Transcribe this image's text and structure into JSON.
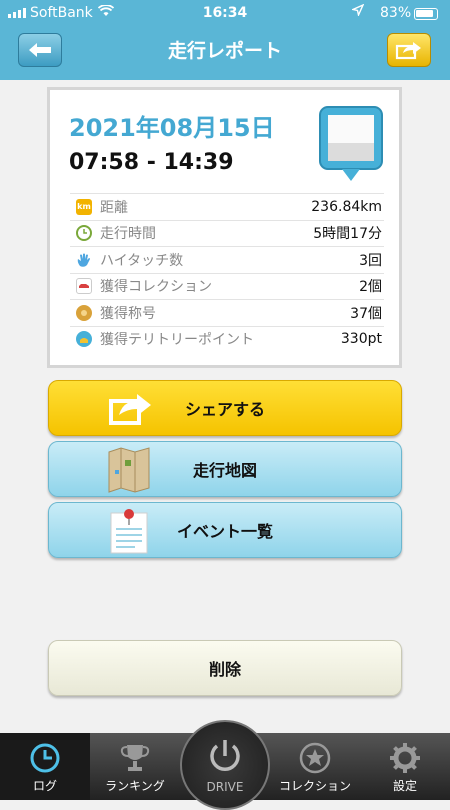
{
  "status": {
    "carrier": "SoftBank",
    "time": "16:34",
    "battery": "83%"
  },
  "nav": {
    "title": "走行レポート"
  },
  "report": {
    "date": "2021年08月15日",
    "time_range": "07:58 - 14:39",
    "rows": [
      {
        "label": "距離",
        "value": "236.84km",
        "icon": "km-icon",
        "icon_text": "km",
        "color": "#f2b300"
      },
      {
        "label": "走行時間",
        "value": "5時間17分",
        "icon": "clock-icon",
        "icon_text": "",
        "color": "#7aa83a"
      },
      {
        "label": "ハイタッチ数",
        "value": "3回",
        "icon": "hand-icon",
        "icon_text": "",
        "color": "#4ea6e0"
      },
      {
        "label": "獲得コレクション",
        "value": "2個",
        "icon": "car-icon",
        "icon_text": "",
        "color": "#d94040"
      },
      {
        "label": "獲得称号",
        "value": "37個",
        "icon": "medal-icon",
        "icon_text": "",
        "color": "#d9a23a"
      },
      {
        "label": "獲得テリトリーポイント",
        "value": "330pt",
        "icon": "globe-icon",
        "icon_text": "",
        "color": "#46b0d8"
      }
    ]
  },
  "buttons": {
    "share": "シェアする",
    "map": "走行地図",
    "events": "イベント一覧",
    "delete": "削除"
  },
  "tabs": {
    "log": "ログ",
    "ranking": "ランキング",
    "drive": "DRIVE",
    "collection": "コレクション",
    "settings": "設定"
  }
}
